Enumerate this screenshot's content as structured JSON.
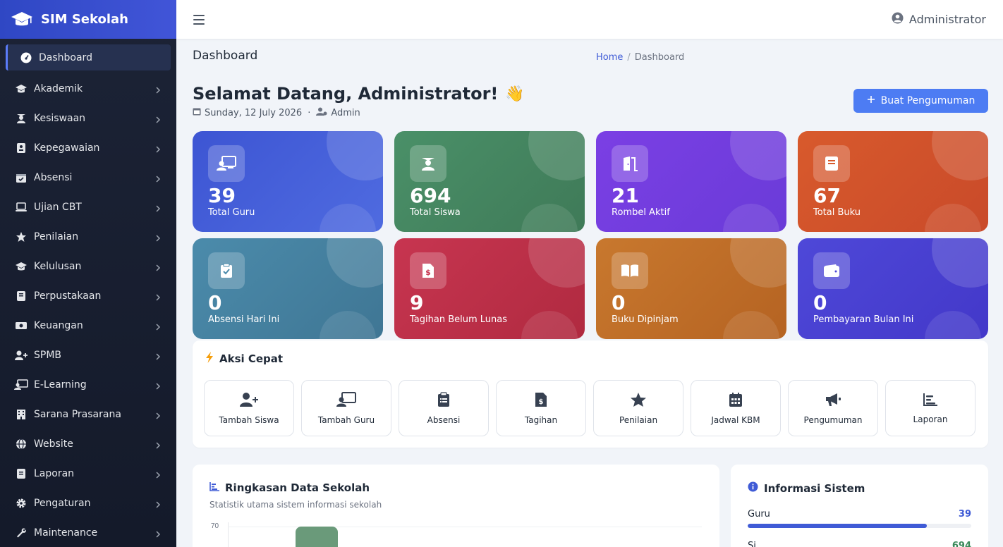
{
  "app": {
    "name": "SIM Sekolah",
    "icon": "graduation-cap-icon"
  },
  "sidebar": {
    "items": [
      {
        "label": "Dashboard",
        "icon": "gauge-icon",
        "active": true
      },
      {
        "label": "Akademik",
        "icon": "graduation-cap-icon"
      },
      {
        "label": "Kesiswaan",
        "icon": "student-icon"
      },
      {
        "label": "Kepegawaian",
        "icon": "id-badge-icon"
      },
      {
        "label": "Absensi",
        "icon": "calendar-check-icon"
      },
      {
        "label": "Ujian CBT",
        "icon": "laptop-icon"
      },
      {
        "label": "Penilaian",
        "icon": "star-icon"
      },
      {
        "label": "Kelulusan",
        "icon": "graduation-cap-icon"
      },
      {
        "label": "Perpustakaan",
        "icon": "book-icon"
      },
      {
        "label": "Keuangan",
        "icon": "money-bill-icon"
      },
      {
        "label": "SPMB",
        "icon": "user-plus-icon"
      },
      {
        "label": "E-Learning",
        "icon": "chalkboard-user-icon"
      },
      {
        "label": "Sarana Prasarana",
        "icon": "building-icon"
      },
      {
        "label": "Website",
        "icon": "globe-icon"
      },
      {
        "label": "Laporan",
        "icon": "file-icon"
      },
      {
        "label": "Pengaturan",
        "icon": "gear-icon"
      },
      {
        "label": "Maintenance",
        "icon": "wrench-icon"
      }
    ]
  },
  "topbar": {
    "user": "Administrator"
  },
  "page": {
    "title": "Dashboard",
    "breadcrumb": {
      "home": "Home",
      "separator": "/",
      "current": "Dashboard"
    }
  },
  "welcome": {
    "heading": "Selamat Datang, Administrator!",
    "emoji": "👋",
    "date": "Sunday, 12 July 2026",
    "dot": "·",
    "role": "Admin",
    "announce_button": "Buat Pengumuman"
  },
  "stats": [
    {
      "value": "39",
      "label": "Total Guru",
      "color": "#3f57d4",
      "icon": "chalkboard-user-icon"
    },
    {
      "value": "694",
      "label": "Total Siswa",
      "color": "#4a8a64",
      "icon": "student-icon"
    },
    {
      "value": "21",
      "label": "Rombel Aktif",
      "color": "#7a3fe0",
      "icon": "door-open-icon"
    },
    {
      "value": "67",
      "label": "Total Buku",
      "color": "#d4542a",
      "icon": "book-icon"
    },
    {
      "value": "0",
      "label": "Absensi Hari Ini",
      "color": "#4a86a6",
      "icon": "clipboard-check-icon"
    },
    {
      "value": "9",
      "label": "Tagihan Belum Lunas",
      "color": "#c2324a",
      "icon": "file-invoice-dollar-icon"
    },
    {
      "value": "0",
      "label": "Buku Dipinjam",
      "color": "#c4702a",
      "icon": "book-open-icon"
    },
    {
      "value": "0",
      "label": "Pembayaran Bulan Ini",
      "color": "#4a45d4",
      "icon": "wallet-icon"
    }
  ],
  "quick_actions": {
    "title": "Aksi Cepat",
    "items": [
      {
        "label": "Tambah Siswa",
        "icon": "user-plus-icon"
      },
      {
        "label": "Tambah Guru",
        "icon": "chalkboard-user-icon"
      },
      {
        "label": "Absensi",
        "icon": "clipboard-icon"
      },
      {
        "label": "Tagihan",
        "icon": "file-invoice-dollar-icon"
      },
      {
        "label": "Penilaian",
        "icon": "star-icon"
      },
      {
        "label": "Jadwal KBM",
        "icon": "calendar-icon"
      },
      {
        "label": "Pengumuman",
        "icon": "bullhorn-icon"
      },
      {
        "label": "Laporan",
        "icon": "chart-bar-icon"
      }
    ]
  },
  "summary": {
    "title": "Ringkasan Data Sekolah",
    "subtitle": "Statistik utama sistem informasi sekolah",
    "chart_tick": "70"
  },
  "system_info": {
    "title": "Informasi Sistem",
    "rows": [
      {
        "label": "Guru",
        "value": "39",
        "progress": 0.8
      },
      {
        "label": "Si",
        "value": "694"
      }
    ]
  },
  "colors": {
    "primary": "#3f5bd6",
    "button": "#4d7cf3",
    "sidebar": "#1c2336"
  }
}
